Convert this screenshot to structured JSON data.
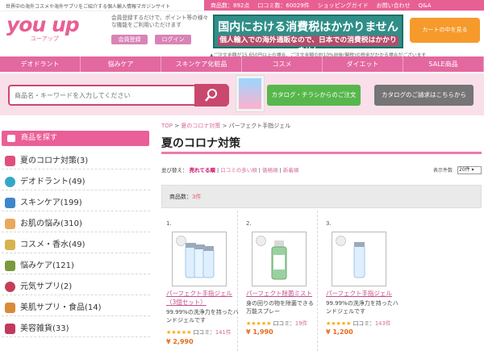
{
  "topbar": {
    "tagline": "世界中の海外コスメや海外サプリをご紹介する個人輸入情報マガジンサイト",
    "products": "商品数：892点",
    "reviews": "口コミ数：60029件",
    "guide": "ショッピングガイド",
    "contact": "お問い合わせ",
    "qa": "Q&A"
  },
  "header": {
    "logo": "you up",
    "logo_sub": "ユーアップ",
    "intro": "会員登録するだけで、ポイント等の様々な機能をご利用いただけます",
    "register": "会員登録",
    "login": "ログイン",
    "tax_title": "国内における消費税はかかりません",
    "tax_sub": "個人輸入での海外通販なので、日本での消費税はかかりません",
    "cart": "カートの中を見る",
    "notice": "▲ご注文金額が15,650円以上の場合、ご注文金額の約10%前後(関税)の税金がかかる場合がございます"
  },
  "nav": {
    "items": [
      "デオドラント",
      "悩みケア",
      "スキンケア化粧品",
      "コスメ",
      "ダイエット",
      "SALE商品"
    ]
  },
  "search": {
    "placeholder": "商品名・キーワードを入力してください",
    "catalog": "カタログ・チラシからのご注文",
    "request": "カタログのご請求はこちらから"
  },
  "sidebar": {
    "title": "商品を探す",
    "items": [
      {
        "label": "夏のコロナ対策(3)"
      },
      {
        "label": "デオドラント(49)"
      },
      {
        "label": "スキンケア(199)"
      },
      {
        "label": "お肌の悩み(310)"
      },
      {
        "label": "コスメ・香水(49)"
      },
      {
        "label": "悩みケア(121)"
      },
      {
        "label": "元気サプリ(2)"
      },
      {
        "label": "美肌サプリ・食品(14)"
      },
      {
        "label": "美容雑貨(33)"
      }
    ]
  },
  "breadcrumb": {
    "home": "TOP",
    "cat": "夏のコロナ対策",
    "current": "パーフェクト手指ジェル"
  },
  "page": {
    "title": "夏のコロナ対策",
    "sort_label": "並び替え：",
    "sort_current": "売れてる順",
    "sort_review": "口コミの多い順",
    "sort_price": "価格順",
    "sort_new": "新着順",
    "per_label": "表示件数",
    "per_value": "20件",
    "count_label": "商品数：",
    "count_value": "3件"
  },
  "products": [
    {
      "num": "1.",
      "name": "パーフェクト手指ジェル（3個セット）",
      "desc": "99.99%の洗浄力を持ったハンドジェルです",
      "stars": "★★★★★",
      "review_label": "口コミ：",
      "review_count": "141件",
      "price": "¥ 2,990"
    },
    {
      "num": "2.",
      "name": "パーフェクト除菌ミスト",
      "desc": "身の回りの物を除菌できる万能スプレー",
      "stars": "★★★★★",
      "review_label": "口コミ：",
      "review_count": "19件",
      "price": "¥ 1,990"
    },
    {
      "num": "3.",
      "name": "パーフェクト手指ジェル",
      "desc": "99.99%の洗浄力を持ったハンドジェルです",
      "stars": "★★★★★",
      "review_label": "口コミ：",
      "review_count": "143件",
      "price": "¥ 1,200"
    }
  ]
}
